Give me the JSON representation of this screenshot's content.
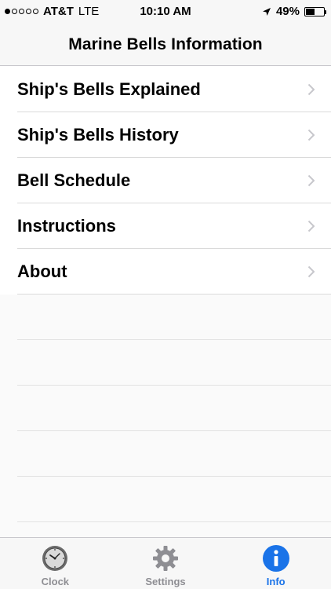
{
  "status_bar": {
    "carrier": "AT&T",
    "network": "LTE",
    "time": "10:10 AM",
    "battery": "49%",
    "battery_level": 0.49,
    "signal_bars_filled": 1,
    "signal_bars_total": 5
  },
  "nav": {
    "title": "Marine Bells Information"
  },
  "list": {
    "items": [
      {
        "label": "Ship's Bells Explained"
      },
      {
        "label": "Ship's Bells History"
      },
      {
        "label": "Bell Schedule"
      },
      {
        "label": "Instructions"
      },
      {
        "label": "About"
      }
    ]
  },
  "tabs": [
    {
      "label": "Clock",
      "icon": "clock-icon",
      "active": false
    },
    {
      "label": "Settings",
      "icon": "gear-icon",
      "active": false
    },
    {
      "label": "Info",
      "icon": "info-icon",
      "active": true
    }
  ],
  "colors": {
    "accent": "#1a73e8",
    "inactive": "#8e8e93",
    "separator": "#dadada",
    "chevron": "#c7c7cc"
  }
}
